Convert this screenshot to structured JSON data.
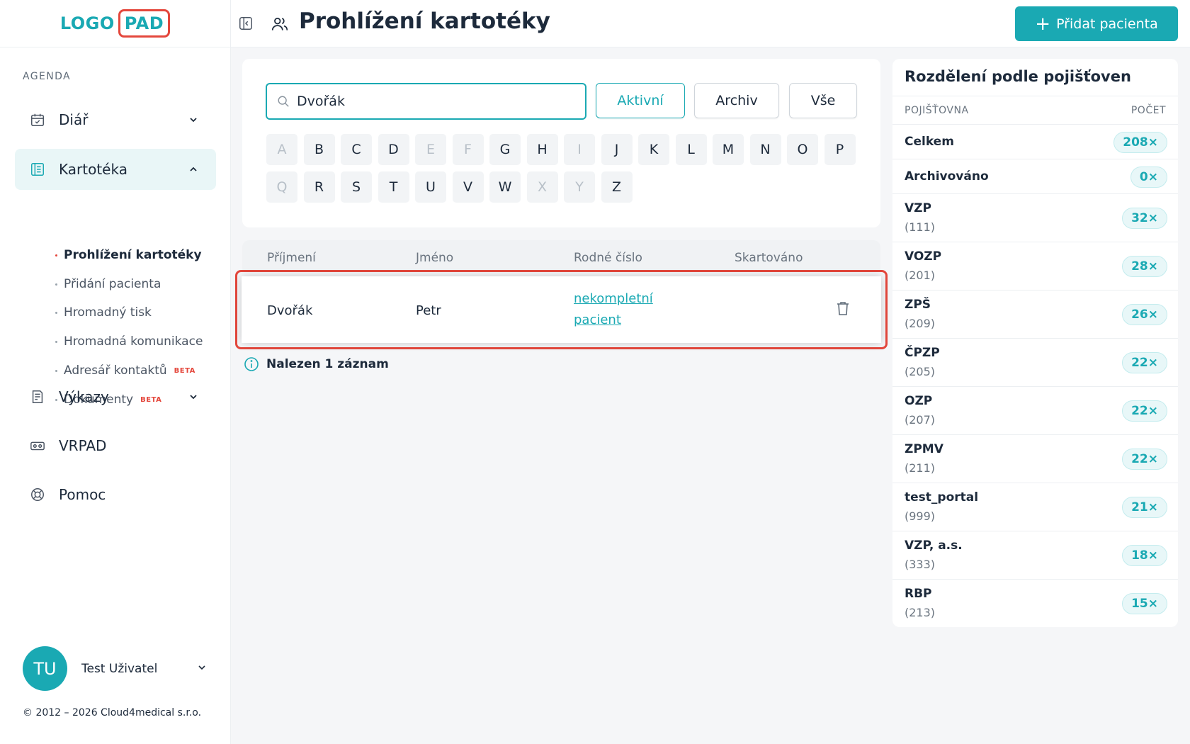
{
  "logo": {
    "part1": "LOGO",
    "part2": "PAD"
  },
  "sidebar": {
    "section_label": "AGENDA",
    "items": [
      {
        "label": "Diář",
        "icon": "calendar-icon"
      },
      {
        "label": "Kartotéka",
        "icon": "card-file-icon"
      },
      {
        "label": "Výkazy",
        "icon": "report-icon"
      },
      {
        "label": "VRPAD",
        "icon": "vr-headset-icon"
      },
      {
        "label": "Pomoc",
        "icon": "lifebuoy-icon"
      }
    ],
    "subitems": [
      {
        "label": "Prohlížení kartotéky",
        "beta": ""
      },
      {
        "label": "Přidání pacienta",
        "beta": ""
      },
      {
        "label": "Hromadný tisk",
        "beta": ""
      },
      {
        "label": "Hromadná komunikace",
        "beta": ""
      },
      {
        "label": "Adresář kontaktů",
        "beta": "BETA"
      },
      {
        "label": "Dokumenty",
        "beta": "BETA"
      }
    ],
    "user": {
      "initials": "TU",
      "name": "Test Uživatel"
    },
    "footer": "© 2012 – 2026 Cloud4medical s.r.o."
  },
  "header": {
    "title": "Prohlížení kartotéky",
    "add_button": "Přidat pacienta"
  },
  "filter": {
    "search_value": "Dvořák",
    "buttons": {
      "active": "Aktivní",
      "archive": "Archiv",
      "all": "Vše"
    },
    "letters_row1": [
      "A",
      "B",
      "C",
      "D",
      "E",
      "F",
      "G",
      "H",
      "I",
      "J",
      "K",
      "L",
      "M",
      "N",
      "O",
      "P"
    ],
    "letters_row2": [
      "Q",
      "R",
      "S",
      "T",
      "U",
      "V",
      "W",
      "X",
      "Y",
      "Z"
    ],
    "disabled_letters": [
      "A",
      "E",
      "F",
      "I",
      "Q",
      "X",
      "Y"
    ]
  },
  "table": {
    "columns": {
      "surname": "Příjmení",
      "name": "Jméno",
      "birth_number": "Rodné číslo",
      "shredded": "Skartováno"
    },
    "row": {
      "surname": "Dvořák",
      "name": "Petr",
      "birth_line1": "nekompletní",
      "birth_line2": "pacient"
    },
    "found_text": "Nalezen 1 záznam"
  },
  "insurance": {
    "title": "Rozdělení podle pojišťoven",
    "col_insurer": "POJIŠŤOVNA",
    "col_count": "POČET",
    "rows": [
      {
        "name": "Celkem",
        "code": "",
        "count": "208×"
      },
      {
        "name": "Archivováno",
        "code": "",
        "count": "0×"
      },
      {
        "name": "VZP",
        "code": "(111)",
        "count": "32×"
      },
      {
        "name": "VOZP",
        "code": "(201)",
        "count": "28×"
      },
      {
        "name": "ZPŠ",
        "code": "(209)",
        "count": "26×"
      },
      {
        "name": "ČPZP",
        "code": "(205)",
        "count": "22×"
      },
      {
        "name": "OZP",
        "code": "(207)",
        "count": "22×"
      },
      {
        "name": "ZPMV",
        "code": "(211)",
        "count": "22×"
      },
      {
        "name": "test_portal",
        "code": "(999)",
        "count": "21×"
      },
      {
        "name": "VZP, a.s.",
        "code": "(333)",
        "count": "18×"
      },
      {
        "name": "RBP",
        "code": "(213)",
        "count": "15×"
      }
    ]
  },
  "colors": {
    "accent": "#1aa9b3",
    "highlight": "#e4473c",
    "text": "#1d2a3b"
  }
}
